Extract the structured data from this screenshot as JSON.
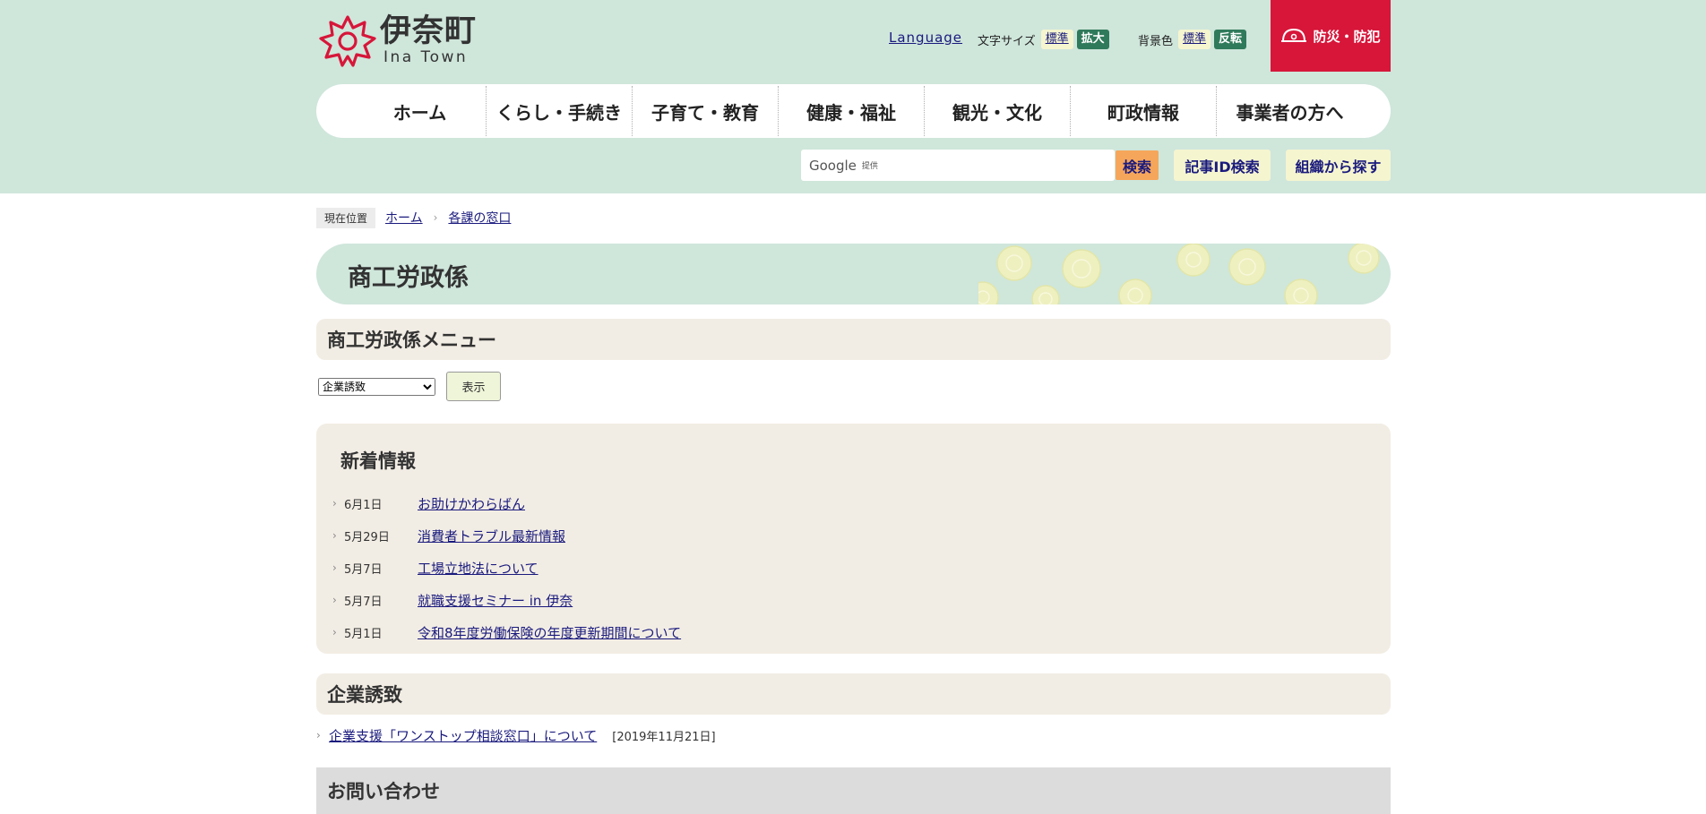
{
  "header": {
    "logo": {
      "jp": "伊奈町",
      "en": "Ina Town"
    },
    "language": "Language",
    "font_size": {
      "label": "文字サイズ",
      "standard": "標準",
      "large": "拡大"
    },
    "bg_color": {
      "label": "背景色",
      "standard": "標準",
      "invert": "反転"
    },
    "bousai": "防災・防犯"
  },
  "gnav": [
    "ホーム",
    "くらし・手続き",
    "子育て・教育",
    "健康・福祉",
    "観光・文化",
    "町政情報",
    "事業者の方へ"
  ],
  "search": {
    "brand": "Google",
    "brand_sub": "提供",
    "button": "検索",
    "id_search": "記事ID検索",
    "org_search": "組織から探す"
  },
  "breadcrumb": {
    "label": "現在位置",
    "items": [
      "ホーム",
      "各課の窓口"
    ]
  },
  "page_title": "商工労政係",
  "menu": {
    "heading": "商工労政係メニュー",
    "selected": "企業誘致",
    "button": "表示"
  },
  "news": {
    "heading": "新着情報",
    "items": [
      {
        "date": "6月1日",
        "title": "お助けかわらばん"
      },
      {
        "date": "5月29日",
        "title": "消費者トラブル最新情報"
      },
      {
        "date": "5月7日",
        "title": "工場立地法について"
      },
      {
        "date": "5月7日",
        "title": "就職支援セミナー in 伊奈"
      },
      {
        "date": "5月1日",
        "title": "令和8年度労働保険の年度更新期間について"
      }
    ]
  },
  "kigyo": {
    "heading": "企業誘致",
    "item": {
      "title": "企業支援「ワンストップ相談窓口」について",
      "date": "[2019年11月21日]"
    }
  },
  "contact": {
    "heading": "お問い合わせ"
  },
  "colors": {
    "header_bg": "#cfe6db",
    "accent_red": "#d7163a",
    "section_bg": "#f2ede4",
    "link": "#1a1a7e"
  }
}
